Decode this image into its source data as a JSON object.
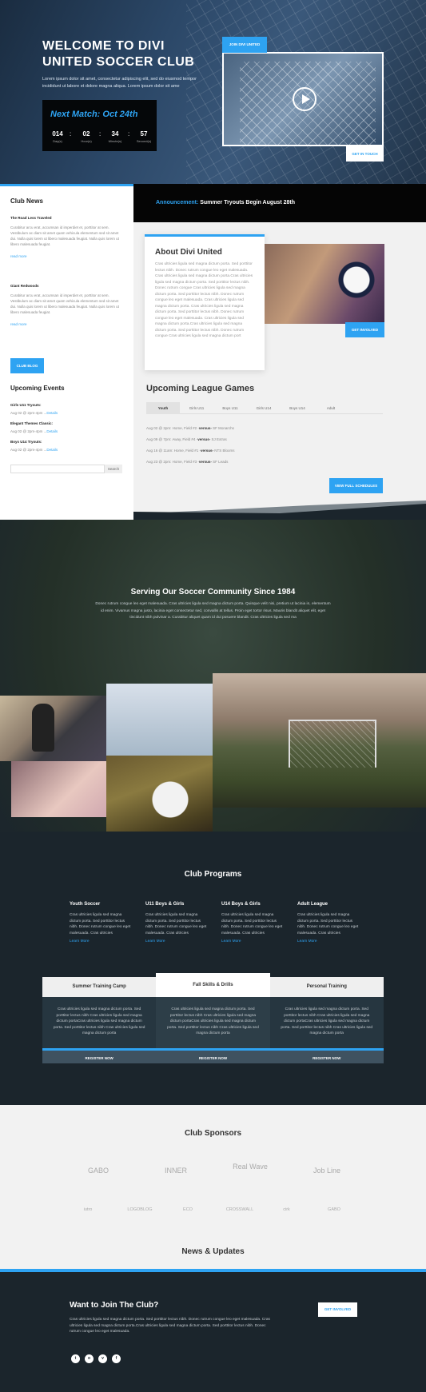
{
  "hero": {
    "title": "WELCOME TO DIVI UNITED SOCCER CLUB",
    "text": "Lorem ipsum dolor sit amet, consectetur adipiscing elit, sed do eiusmod tempor incididunt ut labore et dolore magna aliqua. Lorem ipsum dolor sit ame",
    "next_match": "Next Match: Oct 24th",
    "countdown": [
      {
        "value": "014",
        "unit": "Day(s)"
      },
      {
        "value": "02",
        "unit": "Hour(s)"
      },
      {
        "value": "34",
        "unit": "Minute(s)"
      },
      {
        "value": "57",
        "unit": "Second(s)"
      }
    ],
    "video_tag": "JOIN DIVI UNITED",
    "cta": "GET IN TOUCH"
  },
  "announcement": {
    "label": "Announcement:",
    "text": "Summer Tryouts Begin August 28th"
  },
  "sidebar": {
    "news_title": "Club News",
    "posts": [
      {
        "title": "The Road Less Traveled",
        "text": "Curabitur arcu erat, accumsan id imperdiet et, porttitor at sem. Vestibulum ac diam sit amet quam vehicula elementum sed sit amet dui. Nulla quis lorem ut libero malesuada feugiat. Nulla quis lorem ut libero malesuada feugiat.",
        "more": "read more"
      },
      {
        "title": "Giant Redwoods",
        "text": "Curabitur arcu erat, accumsan id imperdiet et, porttitor at sem. Vestibulum ac diam sit amet quam vehicula elementum sed sit amet dui. Nulla quis lorem ut libero malesuada feugiat. Nulla quis lorem ut libero malesuada feugiat.",
        "more": "read more"
      }
    ],
    "blog_button": "CLUB BLOG",
    "events_title": "Upcoming Events",
    "events": [
      {
        "title": "Girls U11 Tryouts:",
        "date": "Aug 02 @ 2pm-4pm ...",
        "link": "Details"
      },
      {
        "title": "Elegant Themes Classic:",
        "date": "Aug 02 @ 2pm-4pm ...",
        "link": "Details"
      },
      {
        "title": "Boys U14 Tryouts:",
        "date": "Aug 02 @ 2pm-4pm ...",
        "link": "Details"
      }
    ],
    "search_button": "Search"
  },
  "about": {
    "title": "About Divi United",
    "text": "Cras ultricies ligula sed magna dictum porta. Sed porttitor lectus nibh. Donec rutrum congue leo eget malesuada. Cras ultricies ligula sed magna dictum porta.Cras ultricies ligula sed magna dictum porta. Sed porttitor lectus nibh. Donec rutrum congue Cras ultricies ligula sed magna dictum porta. Sed porttitor lectus nibh. Donec rutrum congue leo eget malesuada. Cras ultricies ligula sed magna dictum porta. Cras ultricies ligula sed magna dictum porta. Sed porttitor lectus nibh. Donec rutrum congue leo eget malesuada. Cras ultricies ligula sed magna dictum porta.Cras ultricies ligula sed magna dictum porta. Sed porttitor lectus nibh. Donec rutrum congue Cras ultricies ligula sed magna dictum port",
    "button": "GET INVOLVED"
  },
  "league": {
    "title": "Upcoming League Games",
    "tabs": [
      "Youth",
      "Girls U11",
      "Boys U11",
      "Girls U14",
      "Boys U14",
      "Adult"
    ],
    "games": [
      {
        "info": "Aug 02 @ 2pm: Home, Field #2 -",
        "vs": "versus-",
        "opp": " SF Monarchs"
      },
      {
        "info": "Aug 09 @ 7pm: Away, Field #4 -",
        "vs": "versus-",
        "opp": " SJ Extras"
      },
      {
        "info": "Aug 16 @ 11am: Home, Field #1 -",
        "vs": "versus-",
        "opp": " NTS Blooms"
      },
      {
        "info": "Aug 23 @ 2pm: Home, Field #3 -",
        "vs": "versus-",
        "opp": " SF Leads"
      }
    ],
    "button": "VIEW FULL SCHEDULES"
  },
  "community": {
    "title": "Serving Our Soccer Community Since 1984",
    "text": "Donec rutrum congue leo eget malesuada. Cras ultricies ligula sed magna dictum porta. Quisque velit nisi, pretium ut lacinia in, elementum id enim. Vivamus magna justo, lacinia eget consectetur sed, convallis at tellus. Proin eget tortor risus. Mauris blandit aliquet elit, eget tincidunt nibh pulvinar a. Curabitur aliquet quam id dui posuere blandit. Cras ultricies ligula sed ma"
  },
  "programs": {
    "title": "Club Programs",
    "items": [
      {
        "name": "Youth Soccer",
        "text": "Cras ultricies ligula sed magna dictum porta. Sed porttitor lectus nibh. Donec rutrum congue leo eget malesuada. Cras ultricies",
        "link": "Learn More"
      },
      {
        "name": "U11 Boys & Girls",
        "text": "Cras ultricies ligula sed magna dictum porta. Sed porttitor lectus nibh. Donec rutrum congue leo eget malesuada. Cras ultricies",
        "link": "Learn More"
      },
      {
        "name": "U14 Boys & Girls",
        "text": "Cras ultricies ligula sed magna dictum porta. Sed porttitor lectus nibh. Donec rutrum congue leo eget malesuada. Cras ultricies",
        "link": "Learn More"
      },
      {
        "name": "Adult League",
        "text": "Cras ultricies ligula sed magna dictum porta. Sed porttitor lectus nibh. Donec rutrum congue leo eget malesuada. Cras ultricies",
        "link": "Learn More"
      }
    ],
    "camps": [
      {
        "name": "Summer Training Camp",
        "text": "Cras ultricies ligula sed magna dictum porta. Sed porttitor lectus nibh Cras ultricies ligula sed magna dictum portaCras ultricies ligula sed magna dictum porta. Sed porttitor lectus nibh Cras ultricies ligula sed magna dictum porta",
        "button": "REGISTER NOW"
      },
      {
        "name": "Fall Skills & Drills",
        "text": "Cras ultricies ligula sed magna dictum porta. Sed porttitor lectus nibh Cras ultricies ligula sed magna dictum portaCras ultricies ligula sed magna dictum porta. Sed porttitor lectus nibh Cras ultricies ligula sed magna dictum porta",
        "button": "REGISTER NOW"
      },
      {
        "name": "Personal Training",
        "text": "Cras ultricies ligula sed magna dictum porta. Sed porttitor lectus nibh Cras ultricies ligula sed magna dictum portaCras ultricies ligula sed magna dictum porta. Sed porttitor lectus nibh Cras ultricies ligula sed magna dictum porta",
        "button": "REGISTER NOW"
      }
    ],
    "touch_button": "GET IN TOUCH WITH US"
  },
  "sponsors": {
    "title": "Club Sponsors",
    "logos": [
      "GABO",
      "INNER",
      "Real Wave",
      "Job Line"
    ],
    "logos_small": [
      "iutro",
      "LOGOBLOG",
      "ECO",
      "CROSSWALL",
      "cirk",
      "GABO"
    ]
  },
  "news_title": "News & Updates",
  "footer": {
    "title": "Want to Join The Club?",
    "text": "Cras ultricies ligula sed magna dictum porta. Sed porttitor lectus nibh. Donec rutrum congue leo eget malesuada. Cras ultricies ligula sed magna dictum porta.Cras ultricies ligula sed magna dictum porta. Sed porttitor lectus nibh. Donec rutrum congue leo eget malesuada.",
    "button": "GET INVOLVED",
    "social": [
      "t",
      "o",
      "v",
      "f"
    ]
  }
}
